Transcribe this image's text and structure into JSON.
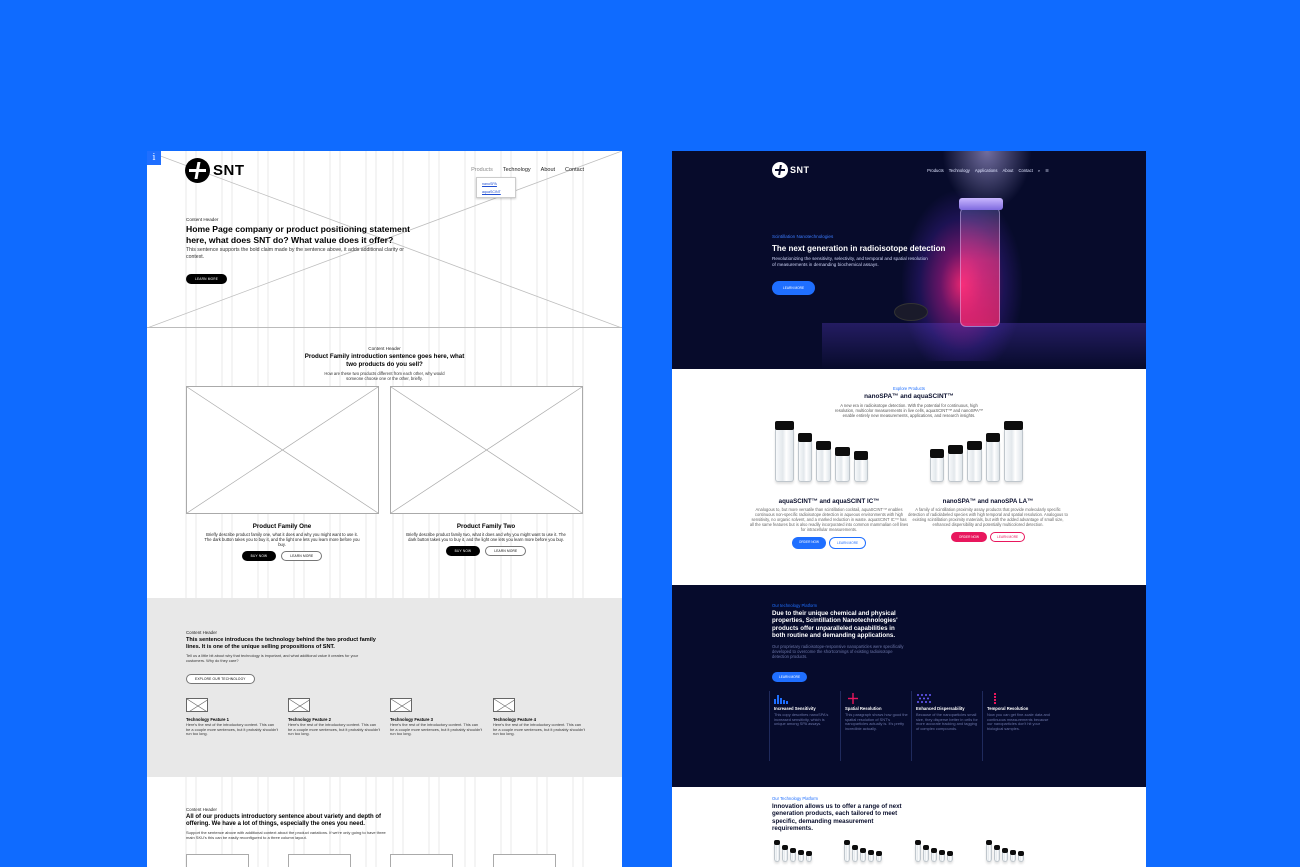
{
  "wireframe": {
    "badge": "i",
    "logo_text": "SNT",
    "nav": [
      "Products",
      "Technology",
      "About",
      "Contact"
    ],
    "dropdown": [
      "nanoSPA",
      "aquaSCINT"
    ],
    "hero": {
      "eyebrow": "Content Header",
      "title": "Home Page company or product positioning statement here, what does SNT do? What value does it offer?",
      "body": "This sentence supports the bold claim made by the sentence above, it adds additional clarity or context.",
      "button": "LEARN MORE"
    },
    "intro": {
      "eyebrow": "Content Header",
      "title": "Product Family introduction sentence goes here, what two products do you sell?",
      "body": "How are these two products different from each other, why would someone choose one or the other, briefly."
    },
    "families": [
      {
        "title": "Product Family One",
        "body": "Briefly describe product family one, what it does and why you might want to use it. The dark button takes you to buy it, and the light one lets you learn more before you buy.",
        "buy": "BUY NOW",
        "learn": "LEARN MORE"
      },
      {
        "title": "Product Family Two",
        "body": "Briefly describe product family two, what it does and why you might want to use it. The dark button takes you to buy it, and the light one lets you learn more before you buy.",
        "buy": "BUY NOW",
        "learn": "LEARN MORE"
      }
    ],
    "tech": {
      "eyebrow": "Content Header",
      "title": "This sentence introduces the technology behind the two product family lines. It is one of the unique selling propositions of SNT.",
      "body": "Tell us a little bit about why that technology is important, and what additional value it creates for your customers. Why do they care?",
      "button": "EXPLORE OUR TECHNOLOGY",
      "features": [
        {
          "title": "Technology Feature 1",
          "body": "Here's the rest of the introductory content. This can be a couple more sentences, but it probably shouldn't run too long."
        },
        {
          "title": "Technology Feature 2",
          "body": "Here's the rest of the introductory content. This can be a couple more sentences, but it probably shouldn't run too long."
        },
        {
          "title": "Technology Feature 3",
          "body": "Here's the rest of the introductory content. This can be a couple more sentences, but it probably shouldn't run too long."
        },
        {
          "title": "Technology Feature 4",
          "body": "Here's the rest of the introductory content. This can be a couple more sentences, but it probably shouldn't run too long."
        }
      ]
    },
    "bottom": {
      "eyebrow": "Content Header",
      "title": "All of our products introductory sentence about variety and depth of offering. We have a lot of things, especially the ones you need.",
      "body": "Support the sentence above with additional context about the product variations. If we're only going to have three main SKU's this can be easily reconfigured to a three column layout."
    }
  },
  "design": {
    "logo_text": "SNT",
    "nav": [
      "Products",
      "Technology",
      "Applications",
      "About",
      "Contact",
      "⌕",
      "☰"
    ],
    "hero": {
      "eyebrow": "Scintillation Nanotechnologies",
      "title": "The next generation in radioisotope detection",
      "body": "Revolutionizing the sensitivity, selectivity, and temporal and spatial resolution of measurements in demanding biochemical assays.",
      "button": "LEARN MORE"
    },
    "explore": {
      "eyebrow": "Explore Products",
      "title": "nanoSPA™ and aquaSCINT™",
      "body": "A new era in radioisotope detection. With the potential for continuous, high resolution, multicolor measurements in live cells, aquaSCINT™ and nanoSPA™ enable entirely new measurements, applications, and research insights."
    },
    "products": [
      {
        "title": "aquaSCINT™ and aquaSCINT IC™",
        "body": "Analogous to, but more versatile than scintillation cocktail, aquaSCINT™ enables continuous non-specific radioisotope detection in aqueous environments with high sensitivity, no organic solvent, and a marked reduction in waste. aquaSCINT IC™ has all the same features but is also readily incorporated into common mammalian cell lines for intracellular measurements.",
        "buy": "ORDER NOW",
        "learn": "LEARN MORE"
      },
      {
        "title": "nanoSPA™ and nanoSPA LA™",
        "body": "A family of scintillation proximity assay products that provide molecularly specific detection of radiolabeled species with high temporal and spatial resolution. Analogous to existing scintillation proximity materials, but with the added advantage of small size, enhanced dispersibility and potentially multicolored detection.",
        "buy": "ORDER NOW",
        "learn": "LEARN MORE"
      }
    ],
    "platform": {
      "eyebrow": "Our technology Platform",
      "title": "Due to their unique chemical and physical properties, Scintillation Nanotechnologies' products offer unparalleled capabilities in both routine and demanding applications.",
      "body": "Our proprietary radioisotope-responsive nanoparticles were specifically developed to overcome the shortcomings of existing radioisotope detection products.",
      "button": "LEARN MORE",
      "features": [
        {
          "title": "Increased Sensitivity",
          "body": "This copy describes nanoSPA's increased sensitivity, which is unique among SPA assays.",
          "color": "#1f6fff"
        },
        {
          "title": "Spatial Resolution",
          "body": "This paragraph shows how good the spatial resolution of SNT's nanoparticles actually is. It's pretty incredible actually.",
          "color": "#e8175d"
        },
        {
          "title": "Enhanced Dispersability",
          "body": "Because of the nanoparticles small size, they disperse better in cells for more accurate tracking and tagging of complex compounds.",
          "color": "#5b4bff"
        },
        {
          "title": "Temporal Resolution",
          "body": "Now you can get fine-scale data and continuous measurements because our nanoparticles don't hit your biological samples.",
          "color": "#e8175d"
        }
      ]
    },
    "range": {
      "eyebrow": "Our Technology Platform",
      "title": "Innovation allows us to offer a range of next generation products, each tailored to meet specific, demanding measurement requirements."
    }
  }
}
